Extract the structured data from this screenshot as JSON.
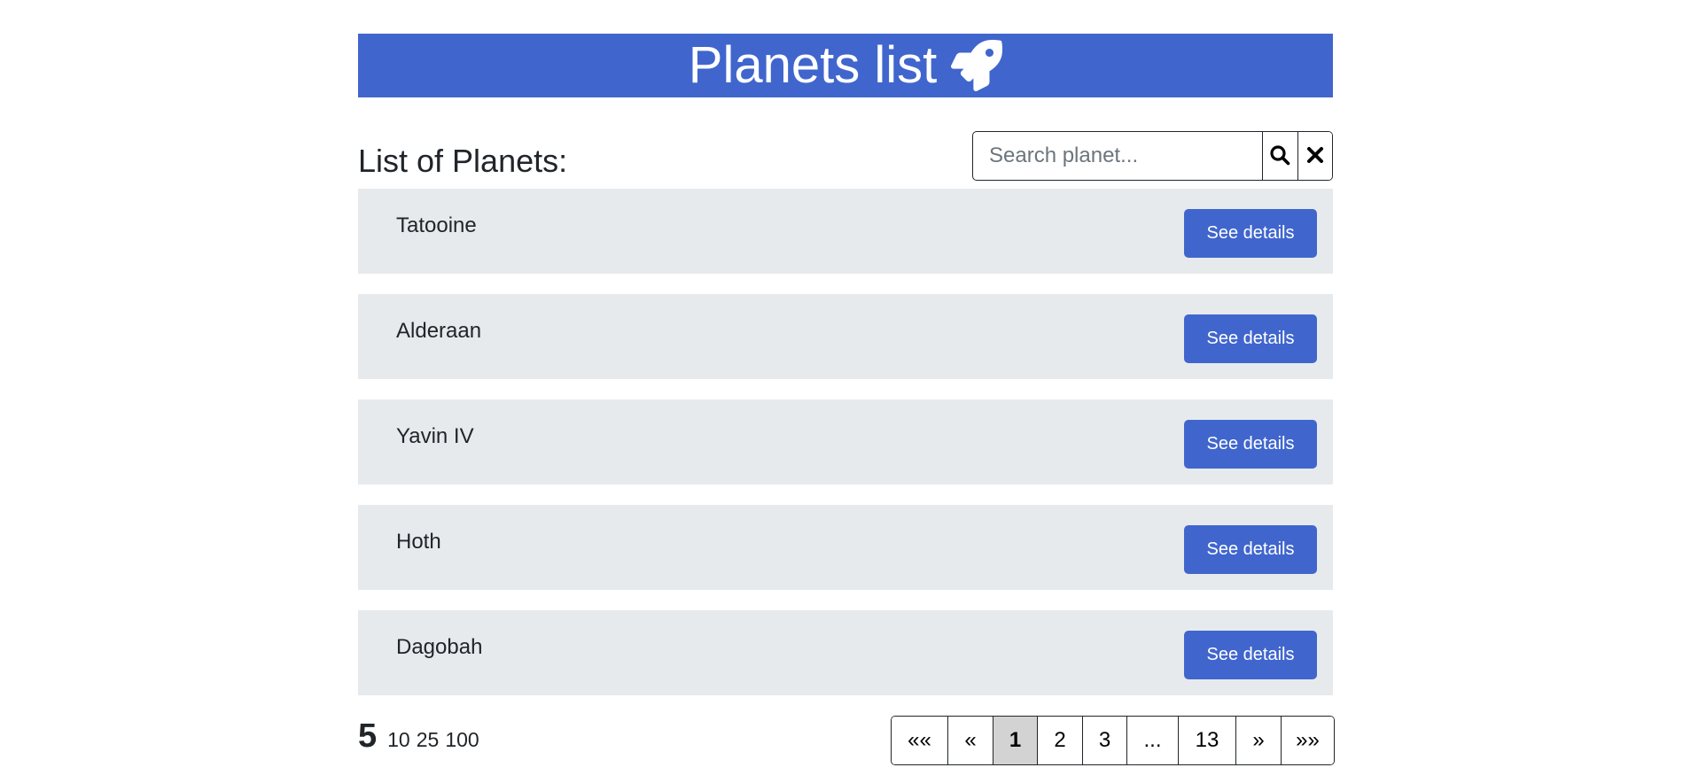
{
  "header": {
    "title": "Planets list",
    "icon": "rocket-icon",
    "background": "#4066cd"
  },
  "list": {
    "heading": "List of Planets:",
    "button_color": "#4066cd",
    "row_background": "#e7eaed",
    "items": [
      {
        "name": "Tatooine",
        "button": "See details"
      },
      {
        "name": "Alderaan",
        "button": "See details"
      },
      {
        "name": "Yavin IV",
        "button": "See details"
      },
      {
        "name": "Hoth",
        "button": "See details"
      },
      {
        "name": "Dagobah",
        "button": "See details"
      }
    ]
  },
  "search": {
    "placeholder": "Search planet...",
    "value": "",
    "search_icon": "search-icon",
    "clear_icon": "close-icon"
  },
  "page_size": {
    "selected": "5",
    "options": [
      "10",
      "25",
      "100"
    ]
  },
  "pagination": {
    "first": "««",
    "prev": "«",
    "pages": [
      "1",
      "2",
      "3"
    ],
    "ellipsis": "...",
    "last_page": "13",
    "next": "»",
    "last": "»»",
    "current": "1"
  }
}
